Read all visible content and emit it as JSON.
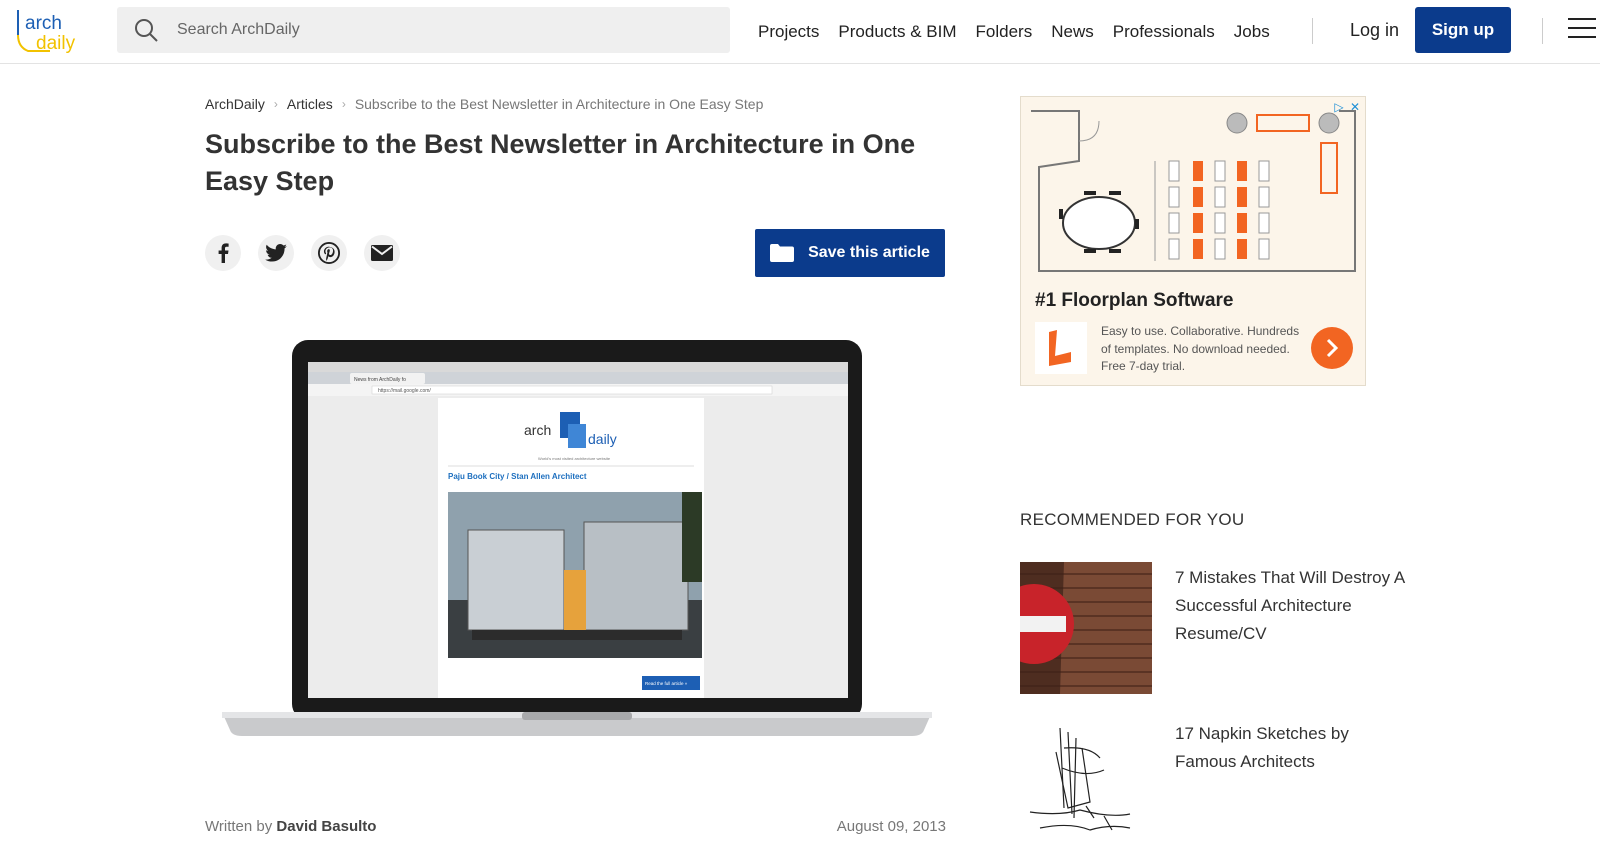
{
  "header": {
    "logo": {
      "line1": "arch",
      "line2": "daily"
    },
    "search_placeholder": "Search ArchDaily",
    "nav": [
      "Projects",
      "Products & BIM",
      "Folders",
      "News",
      "Professionals",
      "Jobs"
    ],
    "login": "Log in",
    "signup": "Sign up"
  },
  "breadcrumb": {
    "items": [
      "ArchDaily",
      "Articles"
    ],
    "current": "Subscribe to the Best Newsletter in Architecture in One Easy Step"
  },
  "article": {
    "title": "Subscribe to the Best Newsletter in Architecture in One Easy Step",
    "save_label": "Save this article",
    "share_icons": [
      "facebook-icon",
      "twitter-icon",
      "pinterest-icon",
      "email-icon"
    ],
    "byline_prefix": "Written by",
    "author": "David Basulto",
    "date": "August 09, 2013",
    "hero_screen": {
      "email_logo_left": "arch",
      "email_logo_right": "daily",
      "tagline": "World's most visited architecture website",
      "headline": "Paju Book City / Stan Allen Architect",
      "button": "Read the full article »",
      "address": "https://mail.google.com/",
      "tab": "News from ArchDaily fo"
    }
  },
  "ad": {
    "title": "#1 Floorplan Software",
    "text": "Easy to use. Collaborative. Hundreds of templates. No download needed. Free 7-day trial.",
    "accent": "#f26522"
  },
  "recommended": {
    "heading": "RECOMMENDED FOR YOU",
    "items": [
      {
        "title": "7 Mistakes That Will Destroy A Successful Architecture Resume/CV"
      },
      {
        "title": "17 Napkin Sketches by Famous Architects"
      }
    ]
  },
  "colors": {
    "primary": "#0b3b8c",
    "logo_blue": "#1d5fb4",
    "logo_yellow": "#f2c200"
  }
}
